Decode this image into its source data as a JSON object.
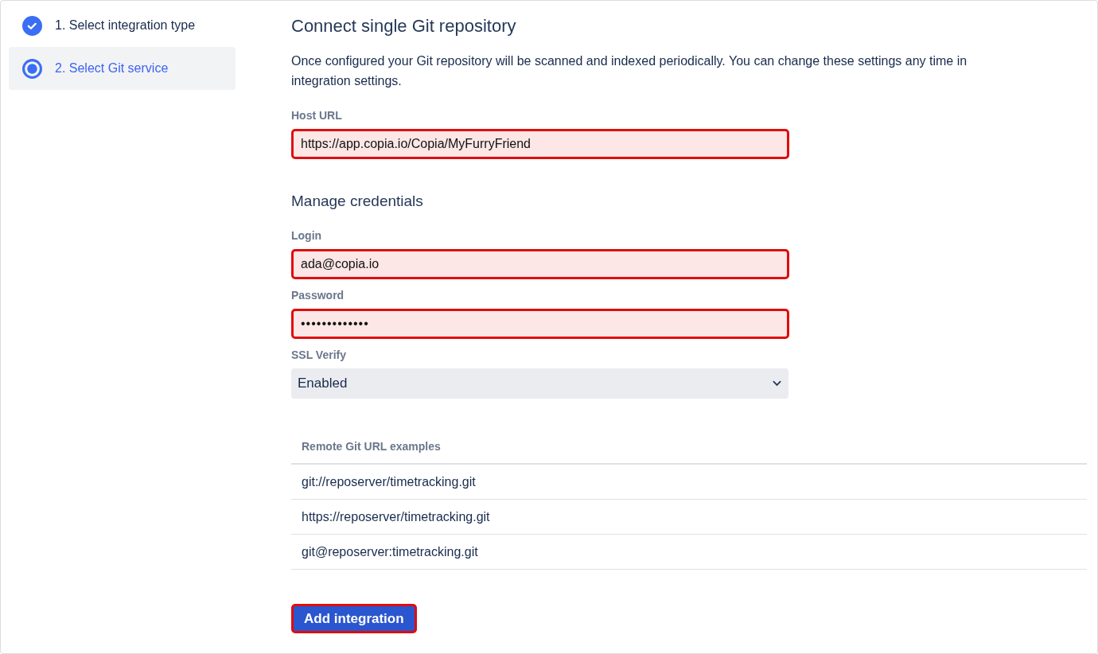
{
  "steps": [
    {
      "label": "1. Select integration type",
      "kind": "done",
      "selected": false
    },
    {
      "label": "2. Select Git service",
      "kind": "current",
      "selected": true
    }
  ],
  "form": {
    "title": "Connect single Git repository",
    "description": "Once configured your Git repository will be scanned and indexed periodically. You can change these settings any time in integration settings.",
    "host_url": {
      "label": "Host URL",
      "value": "https://app.copia.io/Copia/MyFurryFriend",
      "highlighted": true
    },
    "credentials_heading": "Manage credentials",
    "login": {
      "label": "Login",
      "value": "ada@copia.io",
      "highlighted": true
    },
    "password": {
      "label": "Password",
      "value": "•••••••••••••",
      "highlighted": true
    },
    "ssl_verify": {
      "label": "SSL Verify",
      "value": "Enabled"
    }
  },
  "examples_table": {
    "header": "Remote Git URL examples",
    "rows": [
      "git://reposerver/timetracking.git",
      "https://reposerver/timetracking.git",
      "git@reposerver:timetracking.git"
    ]
  },
  "add_button": {
    "label": "Add integration",
    "highlighted": true
  }
}
